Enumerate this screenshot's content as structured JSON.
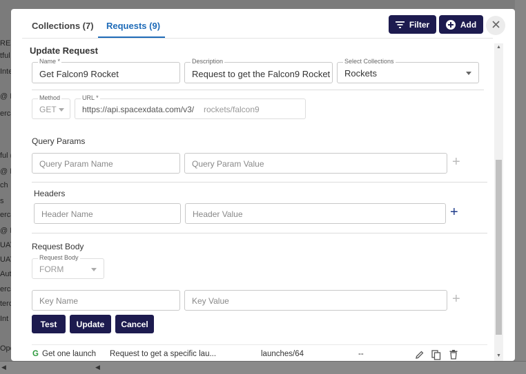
{
  "background": {
    "sidebar_fragments": [
      "REST",
      "tful",
      "Inte",
      "@ In",
      "erca",
      "ful (",
      "@ In",
      "ch",
      "s",
      "erca",
      "@ In",
      "UAT",
      "UAT",
      "Aut",
      "erca",
      "terc",
      "Int",
      "Oper"
    ]
  },
  "tabs": [
    {
      "label": "Collections (7)"
    },
    {
      "label": "Requests (9)"
    }
  ],
  "header_buttons": {
    "filter_label": "Filter",
    "add_label": "Add"
  },
  "update_request": {
    "title": "Update Request",
    "name": {
      "label": "Name *",
      "value": "Get Falcon9 Rocket"
    },
    "description": {
      "label": "Description",
      "value": "Request to get the Falcon9 Rocket"
    },
    "collections": {
      "label": "Select Collections",
      "value": "Rockets"
    },
    "method": {
      "label": "Method",
      "value": "GET"
    },
    "url": {
      "label": "URL *",
      "base": "https://api.spacexdata.com/v3/",
      "path": "rockets/falcon9"
    }
  },
  "query_params": {
    "title": "Query Params",
    "name_placeholder": "Query Param Name",
    "value_placeholder": "Query Param Value"
  },
  "headers": {
    "title": "Headers",
    "name_placeholder": "Header Name",
    "value_placeholder": "Header Value"
  },
  "request_body": {
    "title": "Request Body",
    "type_label": "Request Body",
    "type_value": "FORM",
    "key_placeholder": "Key Name",
    "value_placeholder": "Key Value"
  },
  "actions": {
    "test_label": "Test",
    "update_label": "Update",
    "cancel_label": "Cancel"
  },
  "list_row": {
    "method_badge": "G",
    "name": "Get one launch",
    "description": "Request to get a specific lau...",
    "path": "launches/64",
    "extra": "--"
  },
  "colors": {
    "accent": "#1e6bb8",
    "primary_button": "#1d1b4f",
    "method_get": "#2e9a3e"
  }
}
